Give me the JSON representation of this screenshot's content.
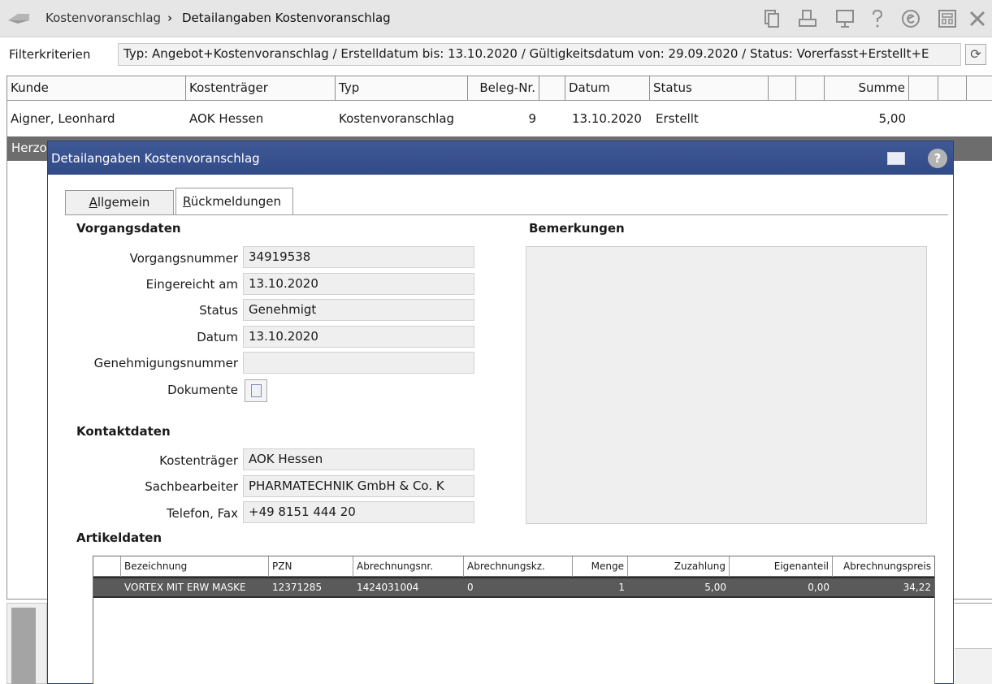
{
  "topbar": {
    "breadcrumb_parent": "Kostenvoranschlag",
    "breadcrumb_sep": "›",
    "breadcrumb_current": "Detailangaben Kostenvoranschlag"
  },
  "filter": {
    "label": "Filterkriterien",
    "value": "Typ: Angebot+Kostenvoranschlag / Erstelldatum bis: 13.10.2020 / Gültigkeitsdatum von: 29.09.2020 / Status: Vorerfasst+Erstellt+E"
  },
  "main_table": {
    "headers": [
      "Kunde",
      "Kostenträger",
      "Typ",
      "Beleg-Nr.",
      "Datum",
      "Status",
      "Summe"
    ],
    "row": {
      "kunde": "Aigner, Leonhard",
      "kostentraeger": "AOK Hessen",
      "typ": "Kostenvoranschlag",
      "beleg_nr": "9",
      "datum": "13.10.2020",
      "status": "Erstellt",
      "summe": "5,00"
    },
    "band_text": "Herzo"
  },
  "dialog": {
    "title": "Detailangaben Kostenvoranschlag",
    "help": "?",
    "tabs": {
      "allgemein_first": "A",
      "allgemein_rest": "llgemein",
      "rueck_first": "R",
      "rueck_rest": "ückmeldungen"
    },
    "vorgangsdaten": {
      "title": "Vorgangsdaten",
      "vorgangsnummer_label": "Vorgangsnummer",
      "vorgangsnummer": "34919538",
      "eingereicht_label": "Eingereicht am",
      "eingereicht": "13.10.2020",
      "status_label": "Status",
      "status": "Genehmigt",
      "datum_label": "Datum",
      "datum": "13.10.2020",
      "genehmigungsnummer_label": "Genehmigungsnummer",
      "genehmigungsnummer": "",
      "dokumente_label": "Dokumente"
    },
    "bemerkungen_title": "Bemerkungen",
    "kontaktdaten": {
      "title": "Kontaktdaten",
      "kostentraeger_label": "Kostenträger",
      "kostentraeger": "AOK Hessen",
      "sachbearbeiter_label": "Sachbearbeiter",
      "sachbearbeiter": "PHARMATECHNIK GmbH & Co. K",
      "telefon_label": "Telefon, Fax",
      "telefon": "+49 8151 444 20"
    },
    "artikeldaten": {
      "title": "Artikeldaten",
      "headers": [
        "Bezeichnung",
        "PZN",
        "Abrechnungsnr.",
        "Abrechnungskz.",
        "Menge",
        "Zuzahlung",
        "Eigenanteil",
        "Abrechnungspreis"
      ],
      "row": {
        "bezeichnung": "VORTEX MIT ERW MASKE",
        "pzn": "12371285",
        "abrechnungsnr": "1424031004",
        "abrechnungskz": "0",
        "menge": "1",
        "zuzahlung": "5,00",
        "eigenanteil": "0,00",
        "abrechnungspreis": "34,22"
      }
    }
  }
}
